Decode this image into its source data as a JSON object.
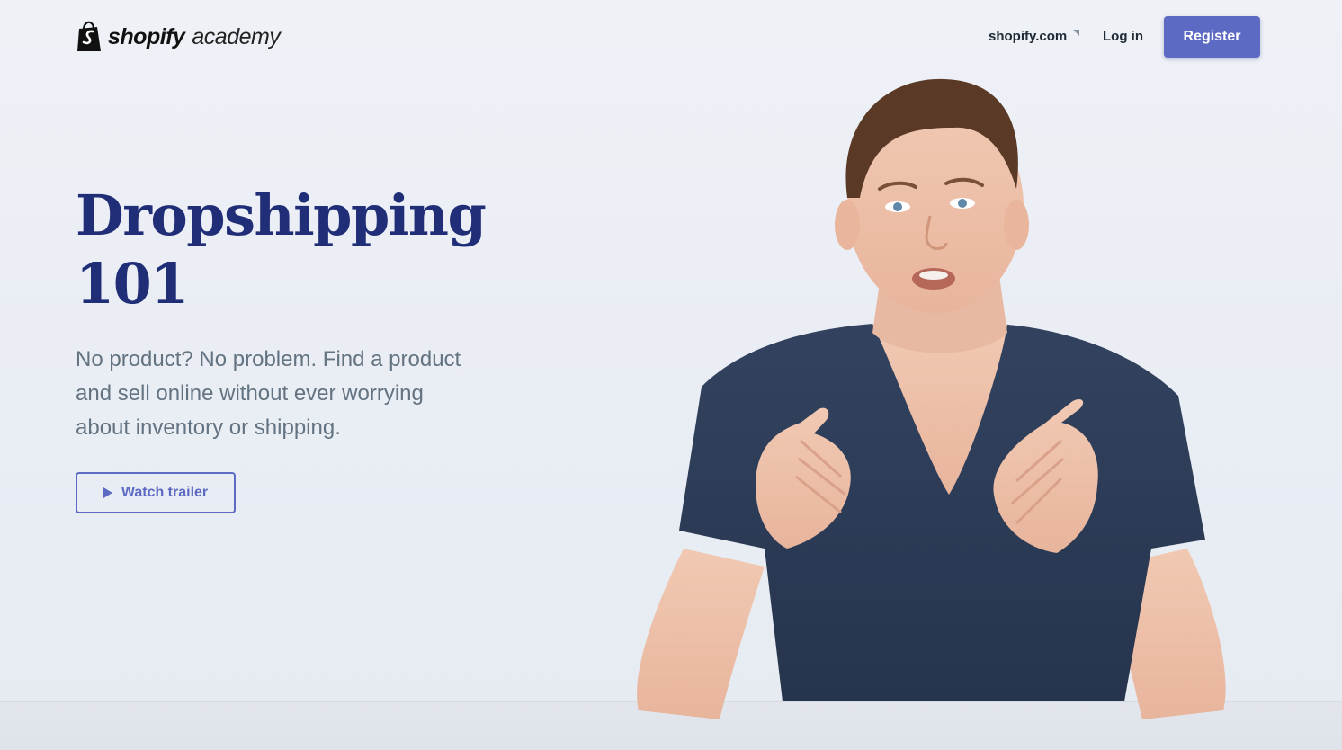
{
  "header": {
    "logo_word": "shopify",
    "logo_sub": "academy",
    "site_link": "shopify.com",
    "login": "Log in",
    "register": "Register"
  },
  "hero": {
    "title_line1": "Dropshipping",
    "title_line2": "101",
    "description": "No product? No problem. Find a product and sell online without ever worrying about inventory or shipping.",
    "watch_trailer": "Watch trailer"
  },
  "icons": {
    "logo": "shopify-bag-icon",
    "external": "external-link-icon",
    "play": "play-icon"
  },
  "colors": {
    "accent": "#5c6ac4",
    "title": "#202e78",
    "body_text": "#637381",
    "background": "#eef1f6",
    "shirt": "#2b3a55"
  }
}
